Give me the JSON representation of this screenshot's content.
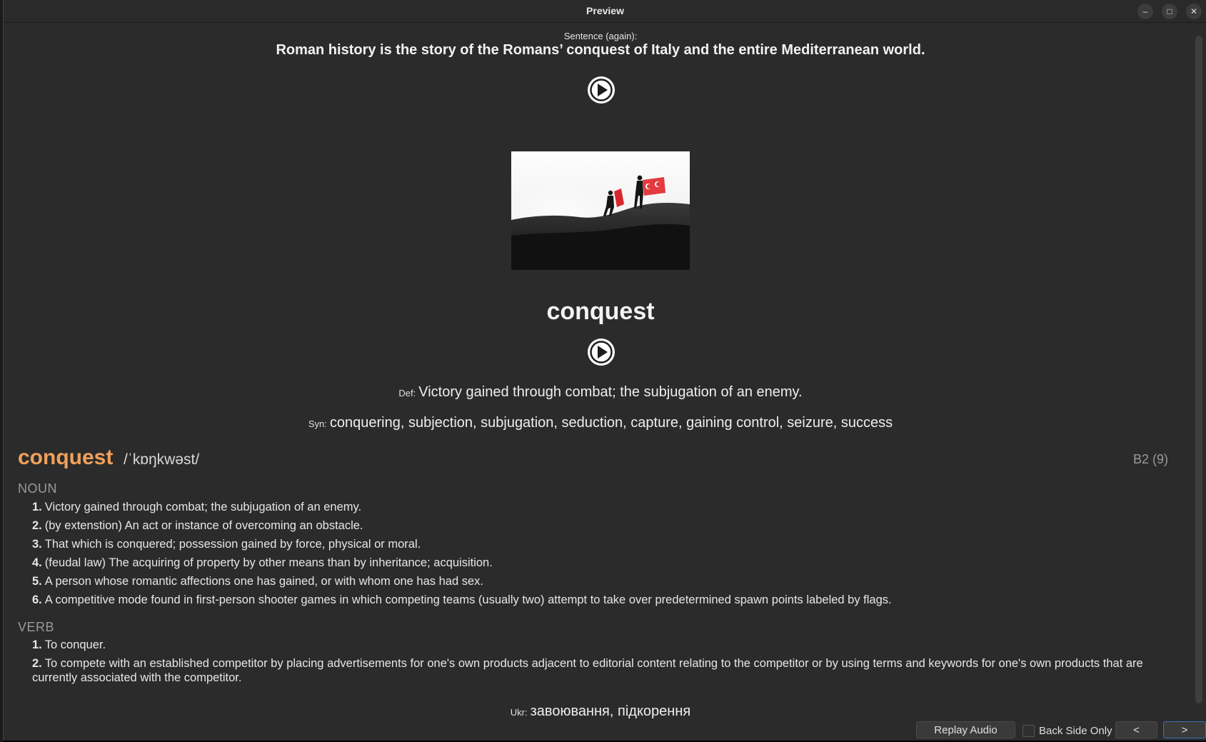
{
  "window": {
    "title": "Preview"
  },
  "window_controls": {
    "minimize": "–",
    "maximize": "□",
    "close": "✕"
  },
  "card": {
    "sentence_label": "Sentence (again):",
    "sentence": "Roman history is the story of the Romans’ conquest of Italy and the entire Mediterranean world.",
    "word": "conquest",
    "def_label": "Def:",
    "definition": "Victory gained through combat; the subjugation of an enemy.",
    "syn_label": "Syn:",
    "synonyms": "conquering, subjection, subjugation, seduction, capture, gaining control, seizure, success",
    "ukr_label": "Ukr:",
    "ukrainian": "завоювання, підкорення"
  },
  "dictionary": {
    "word": "conquest",
    "ipa": "/ˈkɒŋkwəst/",
    "level": "B2 (9)",
    "noun": {
      "label": "NOUN",
      "senses": [
        {
          "num": "1.",
          "text": "Victory gained through combat; the subjugation of an enemy."
        },
        {
          "num": "2.",
          "text": "(by extenstion) An act or instance of overcoming an obstacle."
        },
        {
          "num": "3.",
          "text": "That which is conquered; possession gained by force, physical or moral."
        },
        {
          "num": "4.",
          "text": "(feudal law) The acquiring of property by other means than by inheritance; acquisition."
        },
        {
          "num": "5.",
          "text": "A person whose romantic affections one has gained, or with whom one has had sex."
        },
        {
          "num": "6.",
          "text": "A competitive mode found in first-person shooter games in which competing teams (usually two) attempt to take over predetermined spawn points labeled by flags."
        }
      ]
    },
    "verb": {
      "label": "VERB",
      "senses": [
        {
          "num": "1.",
          "text": "To conquer."
        },
        {
          "num": "2.",
          "text": "To compete with an established competitor by placing advertisements for one's own products adjacent to editorial content relating to the competitor or by using terms and keywords for one's own products that are currently associated with the competitor."
        }
      ]
    }
  },
  "bottombar": {
    "replay_label": "Replay Audio",
    "back_side_label": "Back Side Only",
    "back_side_checked": false,
    "prev_label": "<",
    "next_label": ">"
  },
  "colors": {
    "accent_word": "#f0a15a",
    "background": "#2b2b2b",
    "primary_button_border": "#3d6fb0"
  },
  "icons": {
    "play": "play-circle-icon",
    "image": "soldiers-with-flags-photo"
  }
}
